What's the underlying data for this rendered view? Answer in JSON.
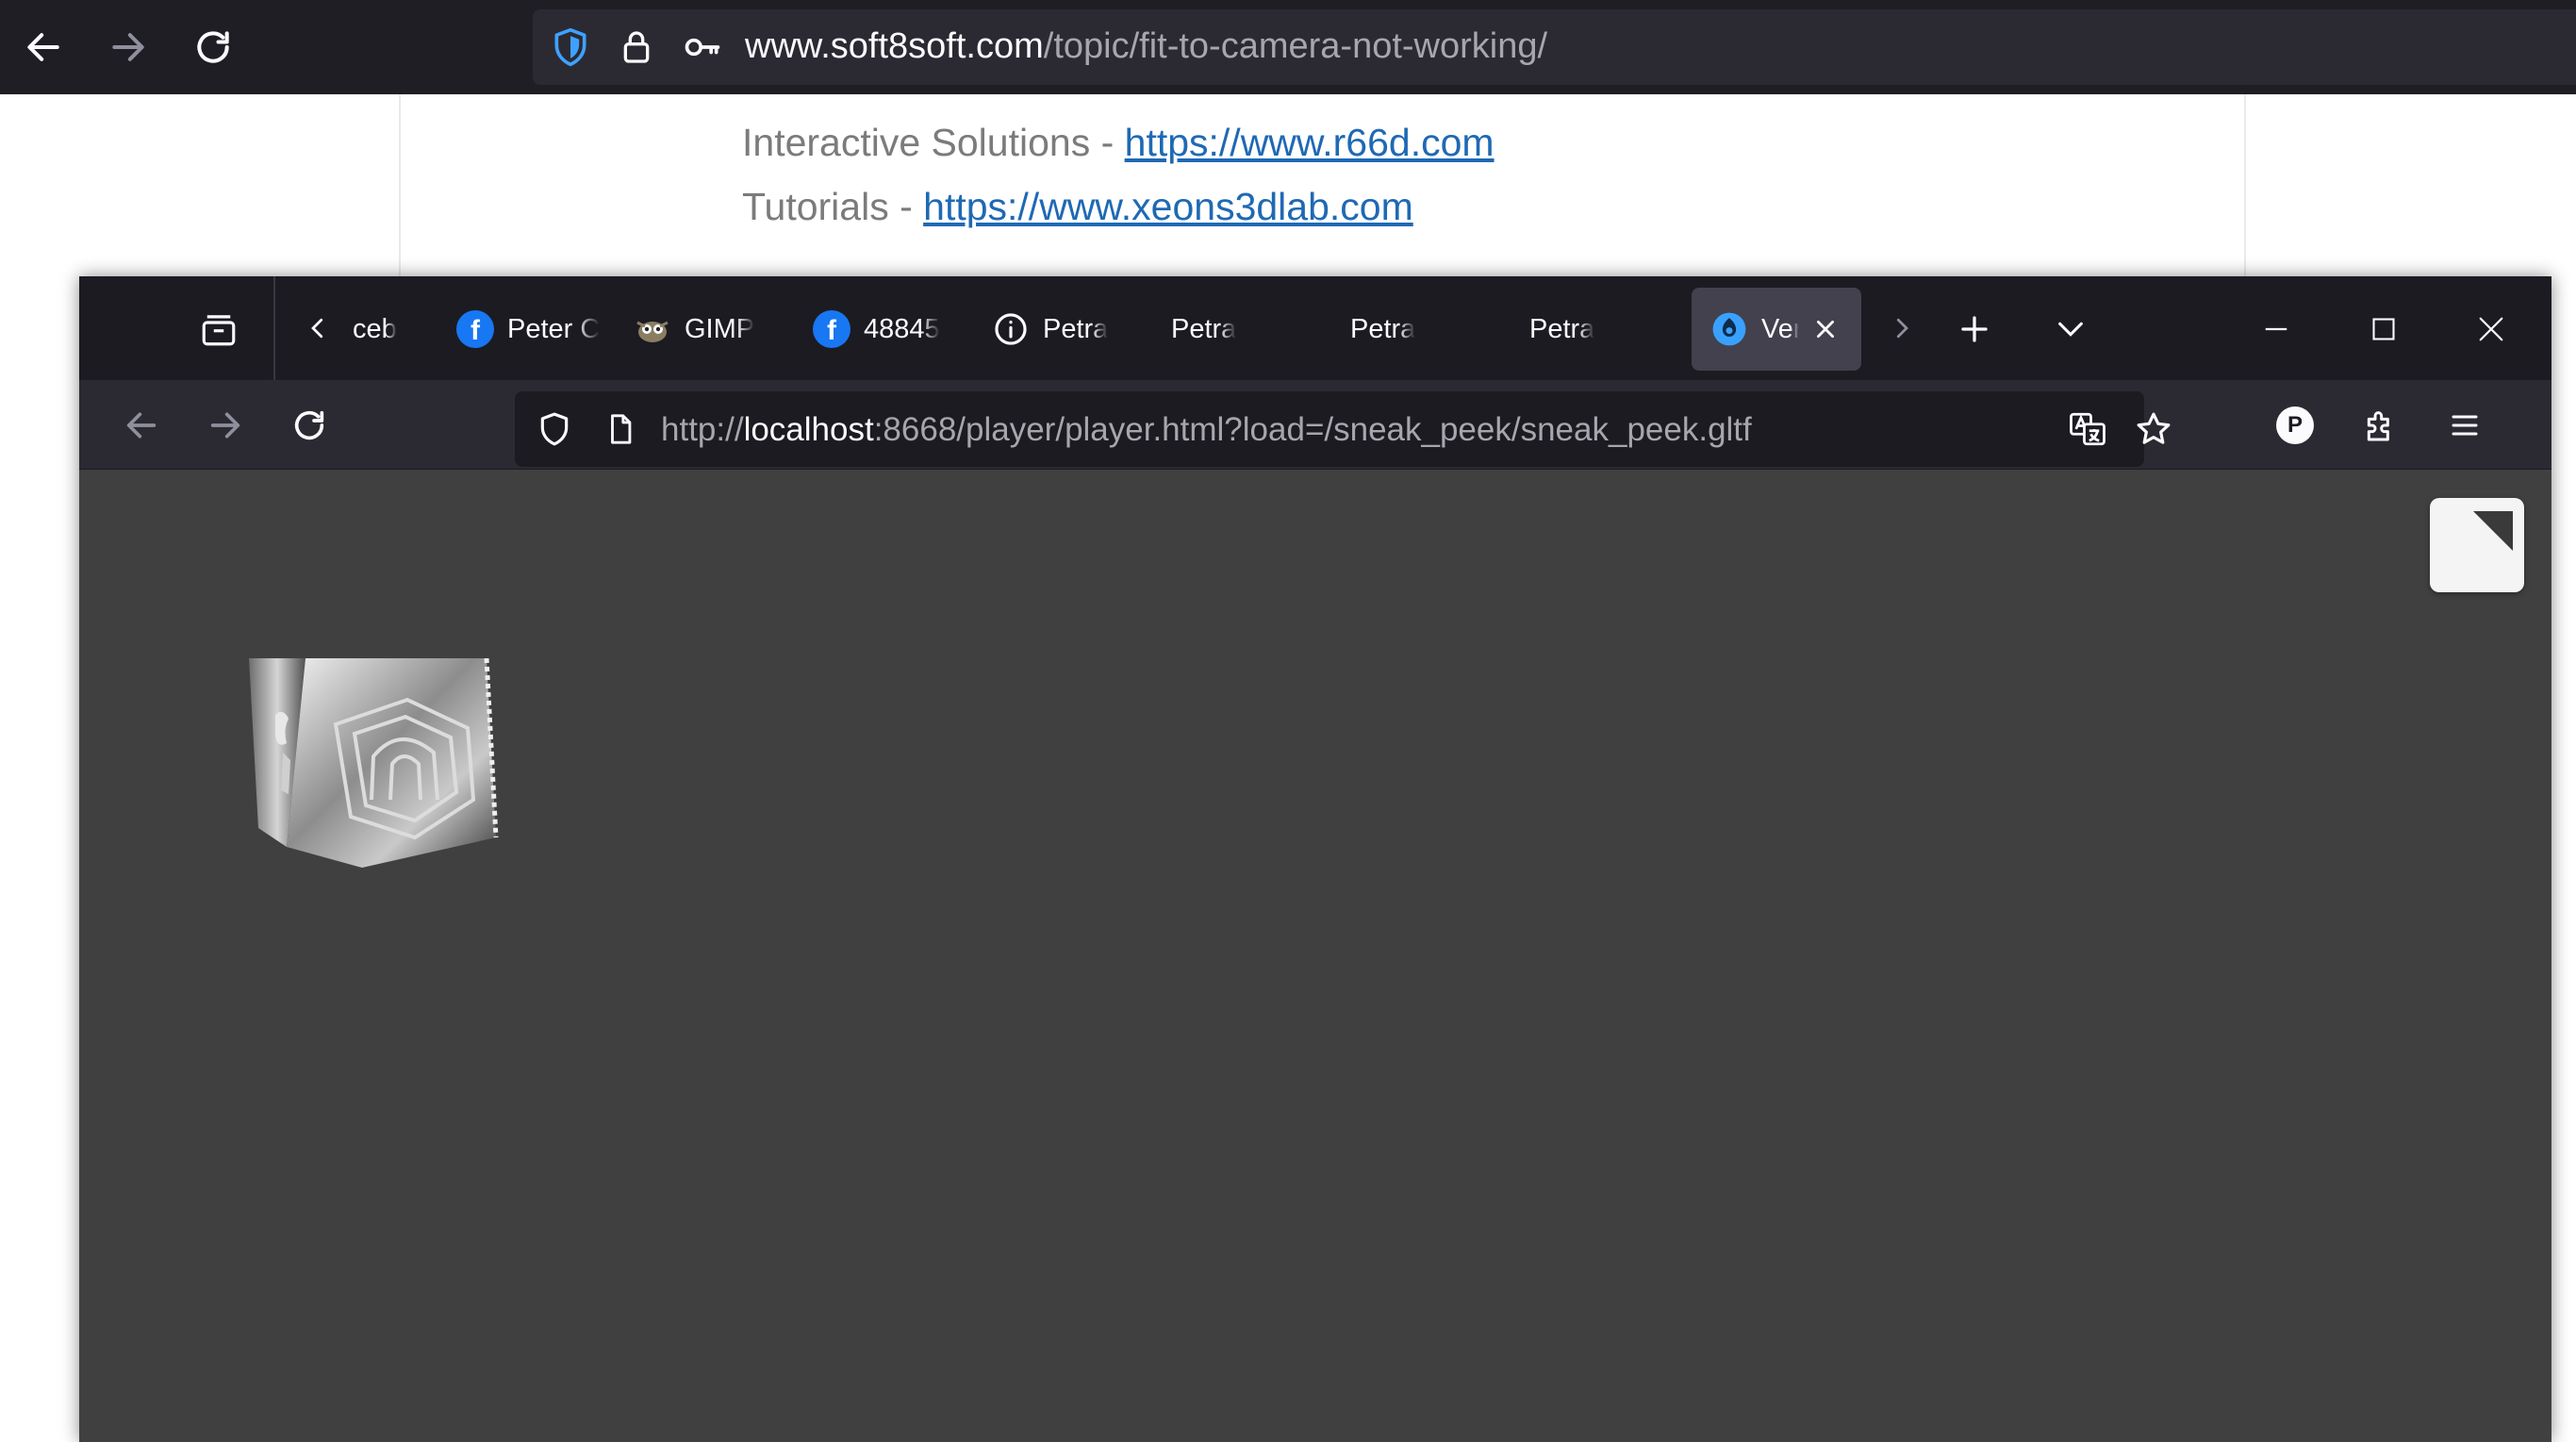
{
  "back_window": {
    "url_host": "www.soft8soft.com",
    "url_path": "/topic/fit-to-camera-not-working/",
    "forum_lines": [
      {
        "prefix": "Interactive Solutions - ",
        "link": "https://www.r66d.com"
      },
      {
        "prefix": "Tutorials - ",
        "link": "https://www.xeons3dlab.com"
      }
    ]
  },
  "front_window": {
    "tabs": [
      {
        "label": "ceb",
        "favicon": "none"
      },
      {
        "label": "Peter C",
        "favicon": "facebook-icon"
      },
      {
        "label": "GIMP",
        "favicon": "gimp-icon"
      },
      {
        "label": "48845",
        "favicon": "facebook-icon"
      },
      {
        "label": "Petra",
        "favicon": "info-icon"
      },
      {
        "label": "Petra",
        "favicon": "none"
      },
      {
        "label": "Petra",
        "favicon": "none"
      },
      {
        "label": "Petra",
        "favicon": "none"
      },
      {
        "label": "Veri",
        "favicon": "verge3d-icon",
        "active": true
      }
    ],
    "url_scheme": "http://",
    "url_host": "localhost",
    "url_rest": ":8668/player/player.html?load=/sneak_peek/sneak_peek.gltf",
    "profile_initial": "P"
  },
  "colors": {
    "back_toolbar": "#1f1e25",
    "front_tabbar": "#1c1b22",
    "front_navbar": "#2b2a33",
    "viewport": "#404040",
    "link": "#1f69b4",
    "shield_accent": "#3fa1ff"
  }
}
